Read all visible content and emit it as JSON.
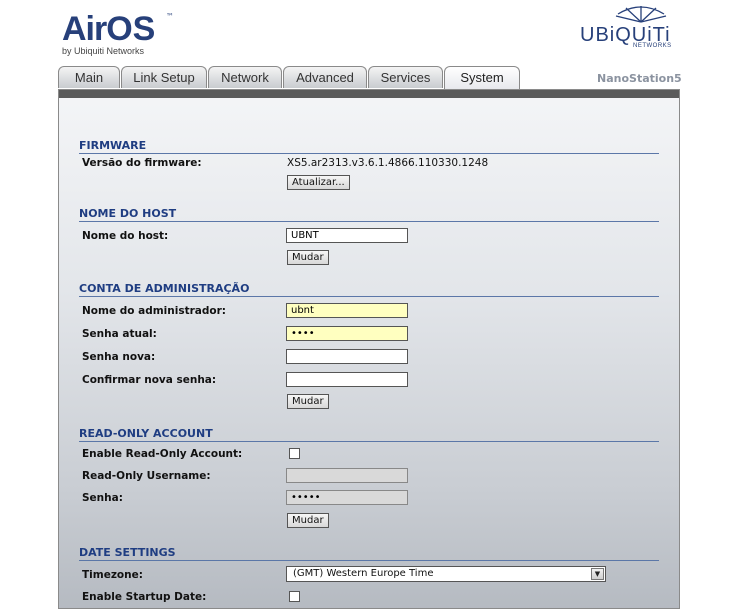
{
  "brand": {
    "airos_air": "Air",
    "airos_os": "OS",
    "airos_tm": "™",
    "airos_sub": "by Ubiquiti Networks",
    "ubiquiti": "UBiQUiTi",
    "ubiquiti_sub": "NETWORKS"
  },
  "tabs": [
    {
      "label": "Main",
      "active": false
    },
    {
      "label": "Link Setup",
      "active": false
    },
    {
      "label": "Network",
      "active": false
    },
    {
      "label": "Advanced",
      "active": false
    },
    {
      "label": "Services",
      "active": false
    },
    {
      "label": "System",
      "active": true
    }
  ],
  "device_name": "NanoStation5",
  "firmware": {
    "title": "FIRMWARE",
    "version_label": "Versão do firmware:",
    "version_value": "XS5.ar2313.v3.6.1.4866.110330.1248",
    "update_button": "Atualizar..."
  },
  "hostname": {
    "title": "NOME DO HOST",
    "label": "Nome do host:",
    "value": "UBNT",
    "button": "Mudar"
  },
  "admin": {
    "title": "CONTA DE ADMINISTRAÇÃO",
    "user_label": "Nome do administrador:",
    "user_value": "ubnt",
    "current_pw_label": "Senha atual:",
    "current_pw_value": "••••",
    "new_pw_label": "Senha nova:",
    "confirm_pw_label": "Confirmar nova senha:",
    "button": "Mudar"
  },
  "readonly": {
    "title": "READ-ONLY ACCOUNT",
    "enable_label": "Enable Read-Only Account:",
    "enabled": false,
    "username_label": "Read-Only Username:",
    "password_label": "Senha:",
    "password_value": "•••••",
    "button": "Mudar"
  },
  "date": {
    "title": "DATE SETTINGS",
    "timezone_label": "Timezone:",
    "timezone_value": "(GMT) Western Europe Time",
    "startup_label": "Enable Startup Date:",
    "startup_enabled": false
  },
  "colors": {
    "accent": "#1f3d82",
    "tab_bar_dark": "#5a5a5a",
    "input_highlight": "#ffffc0"
  }
}
